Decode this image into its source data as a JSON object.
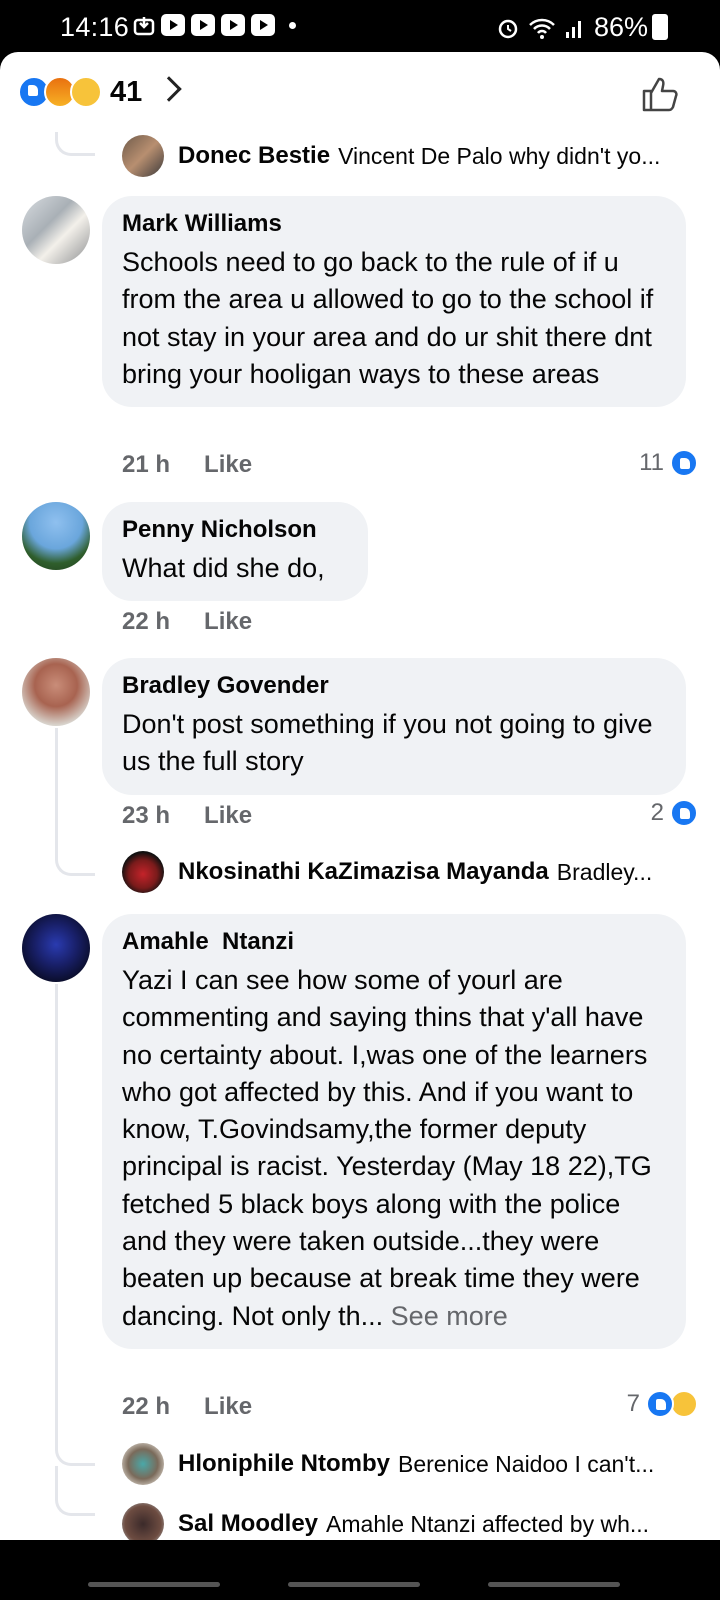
{
  "status_bar": {
    "time": "14:16",
    "battery": "86%"
  },
  "header": {
    "reactions": [
      "like",
      "angry",
      "wow"
    ],
    "reaction_count": "41"
  },
  "replies_top": {
    "name": "Donec Bestie",
    "text": "Vincent De Palo why didn't yo..."
  },
  "comments": [
    {
      "author": "Mark Williams",
      "text": "Schools need to go back to the rule of if u from the area u allowed to go to the school if not stay in your area and do ur shit there dnt bring your hooligan ways to these areas",
      "time": "21 h",
      "like_label": "Like",
      "reactions": "11"
    },
    {
      "author": "Penny Nicholson",
      "text": "What did she do,",
      "time": "22 h",
      "like_label": "Like"
    },
    {
      "author": "Bradley Govender",
      "text": "Don't post something if you not going to give us the full story",
      "time": "23 h",
      "like_label": "Like",
      "reactions": "2",
      "reply": {
        "name": "Nkosinathi KaZimazisa Mayanda",
        "text": "Bradley..."
      }
    },
    {
      "author": "Amahle  Ntanzi",
      "text": "Yazi I can see how some of yourl are commenting and saying thins that y'all have no certainty about. I,was one of the learners who got affected by this. And if you want to know, T.Govindsamy,the former deputy principal is racist. Yesterday (May 18 22),TG fetched 5 black boys along with the police and they were taken outside...they were beaten up because at break time they were dancing. Not only th...",
      "see_more": "See more",
      "time": "22 h",
      "like_label": "Like",
      "reactions": "7",
      "replies": [
        {
          "name": "Hloniphile Ntomby",
          "text": "Berenice Naidoo I can't..."
        },
        {
          "name": "Sal Moodley",
          "text": "Amahle  Ntanzi affected by wh..."
        }
      ]
    }
  ]
}
